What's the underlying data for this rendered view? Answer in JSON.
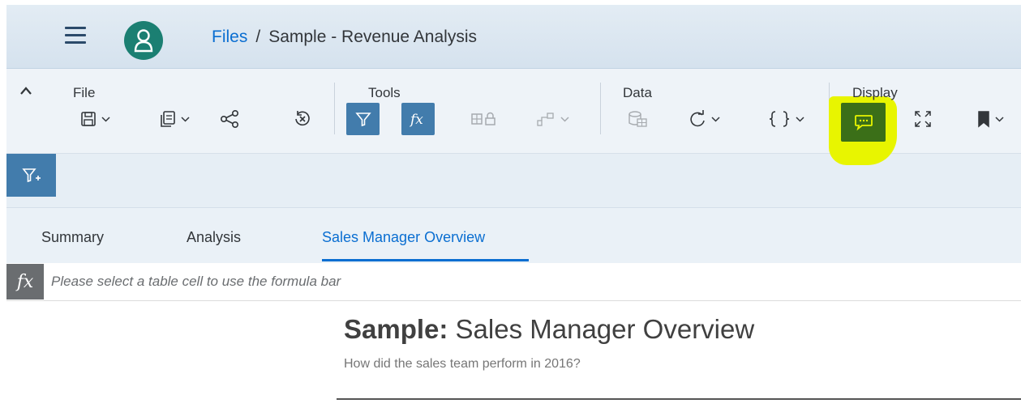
{
  "colors": {
    "shell_bg": "#dbe6f0",
    "brand_blue": "#0a6ed1",
    "active_button": "#427cac",
    "avatar": "#1b7f72",
    "highlight": "#e8f500",
    "highlighted_button": "#3b6f18"
  },
  "header": {
    "menu_icon": "hamburger-icon",
    "avatar_icon": "user-icon",
    "breadcrumb": {
      "root": "Files",
      "separator": "/",
      "current": "Sample - Revenue Analysis"
    }
  },
  "toolbar": {
    "collapse_icon": "chevron-up-icon",
    "groups": {
      "file": {
        "label": "File",
        "buttons": [
          "save-icon",
          "copy-icon",
          "share-icon",
          "revert-icon"
        ]
      },
      "tools": {
        "label": "Tools",
        "buttons": [
          "filter-icon",
          "formula-icon",
          "data-access-icon",
          "chart-icon"
        ]
      },
      "data": {
        "label": "Data",
        "buttons": [
          "database-icon",
          "refresh-icon",
          "script-braces-icon"
        ]
      },
      "display": {
        "label": "Display",
        "buttons": [
          "comment-icon",
          "fullscreen-icon",
          "bookmark-icon"
        ]
      }
    },
    "active_tools": [
      "filter",
      "formula"
    ],
    "highlighted_button": "comment"
  },
  "filterbar": {
    "button_icon": "add-filter-icon"
  },
  "tabs": [
    {
      "label": "Summary",
      "selected": false
    },
    {
      "label": "Analysis",
      "selected": false
    },
    {
      "label": "Sales Manager Overview",
      "selected": true
    }
  ],
  "formula_bar": {
    "icon_label": "fx",
    "placeholder": "Please select a table cell to use the formula bar"
  },
  "content": {
    "title_prefix": "Sample:",
    "title": "Sales Manager Overview",
    "subtitle": "How did the sales team perform in 2016?"
  }
}
